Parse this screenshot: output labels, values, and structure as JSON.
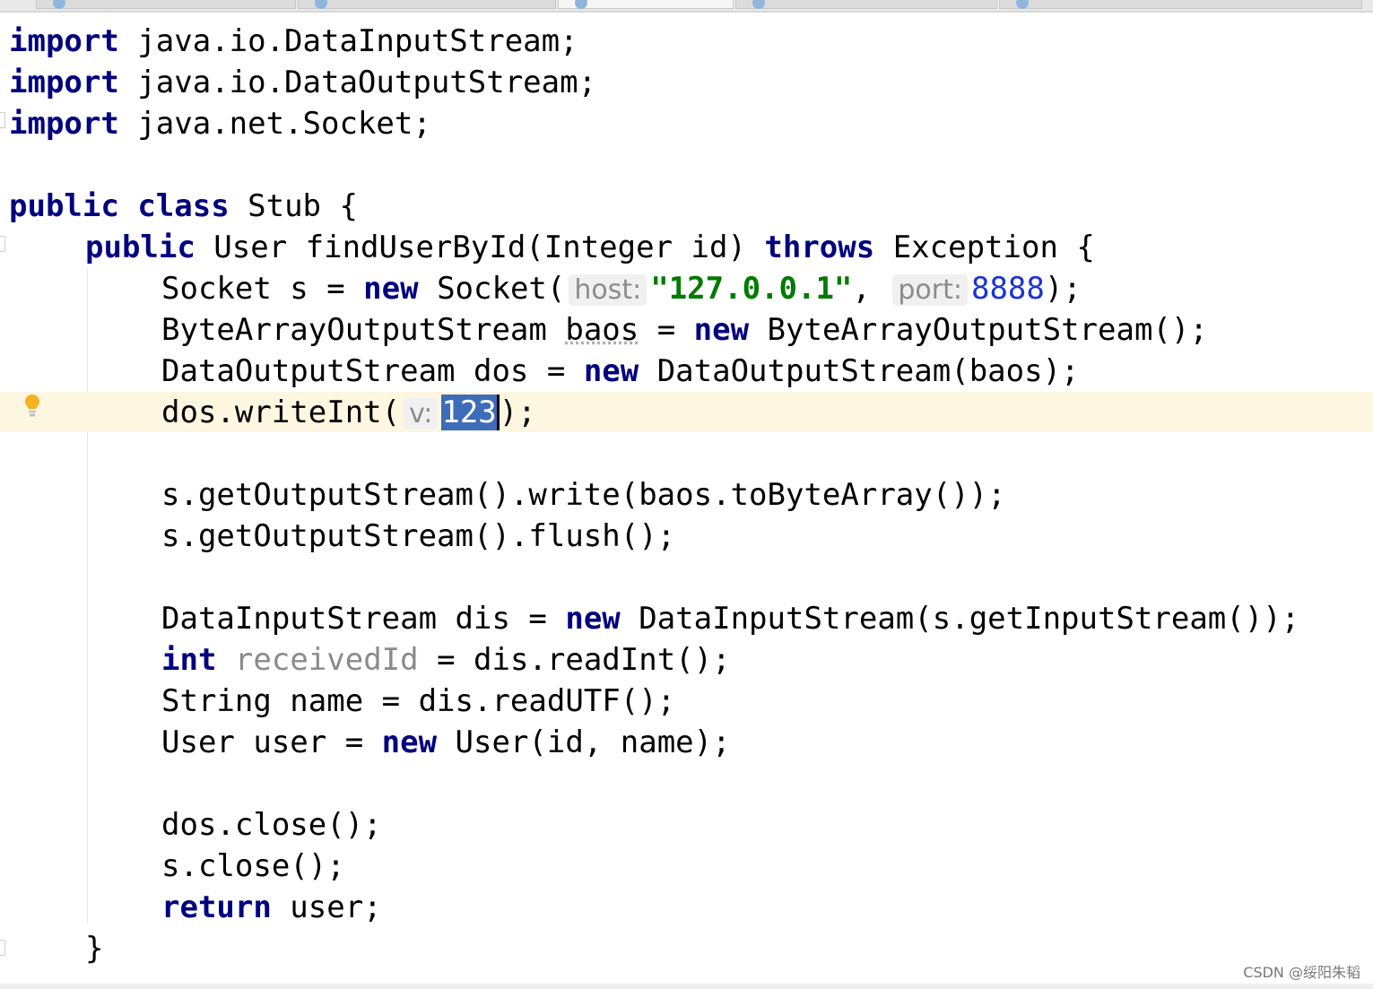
{
  "editor": {
    "tabs": [
      "",
      "",
      "",
      "",
      ""
    ],
    "active_tab_index": 2
  },
  "code": {
    "lines": {
      "l1": {
        "kw": "import",
        "rest": " java.io.DataInputStream;"
      },
      "l2": {
        "kw": "import",
        "rest": " java.io.DataOutputStream;"
      },
      "l3": {
        "kw": "import",
        "rest": " java.net.Socket;"
      },
      "l5": {
        "kw1": "public",
        "sp": " ",
        "kw2": "class",
        "rest": " Stub {"
      },
      "l6": {
        "kw1": "public",
        "mid": " User findUserById(Integer id) ",
        "kw2": "throws",
        "rest": " Exception {"
      },
      "l7": {
        "pre": "Socket s = ",
        "kw": "new",
        "mid": " Socket(",
        "hint1": "host:",
        "str": "\"127.0.0.1\"",
        "comma": ",",
        "hint2": "port:",
        "num": "8888",
        "rest": ");"
      },
      "l8": {
        "pre": "ByteArrayOutputStream ",
        "var": "baos",
        "mid": " = ",
        "kw": "new",
        "rest": " ByteArrayOutputStream();"
      },
      "l9": {
        "pre": "DataOutputStream dos = ",
        "kw": "new",
        "rest": " DataOutputStream(baos);"
      },
      "l10": {
        "pre": "dos.writeInt(",
        "hint": "v:",
        "sel": "123",
        "rest": ");"
      },
      "l12": {
        "text": "s.getOutputStream().write(baos.toByteArray());"
      },
      "l13": {
        "text": "s.getOutputStream().flush();"
      },
      "l15": {
        "pre": "DataInputStream dis = ",
        "kw": "new",
        "rest": " DataInputStream(s.getInputStream());"
      },
      "l16": {
        "kw": "int",
        "sp": " ",
        "unused": "receivedId",
        "rest": " = dis.readInt();"
      },
      "l17": {
        "text": "String name = dis.readUTF();"
      },
      "l18": {
        "pre": "User user = ",
        "kw": "new",
        "rest": " User(id, name);"
      },
      "l20": {
        "text": "dos.close();"
      },
      "l21": {
        "text": "s.close();"
      },
      "l22": {
        "kw": "return",
        "rest": " user;"
      },
      "l23": {
        "text": "}"
      }
    }
  },
  "watermark": "CSDN @绥阳朱韬",
  "colors": {
    "keyword": "#000080",
    "string": "#007a00",
    "number": "#1a33d4",
    "caret_row": "#fdf6e0",
    "selection": "#3d6cb8"
  },
  "icons": {
    "intention": "lightbulb-icon",
    "tab_file": "java-file-icon"
  }
}
